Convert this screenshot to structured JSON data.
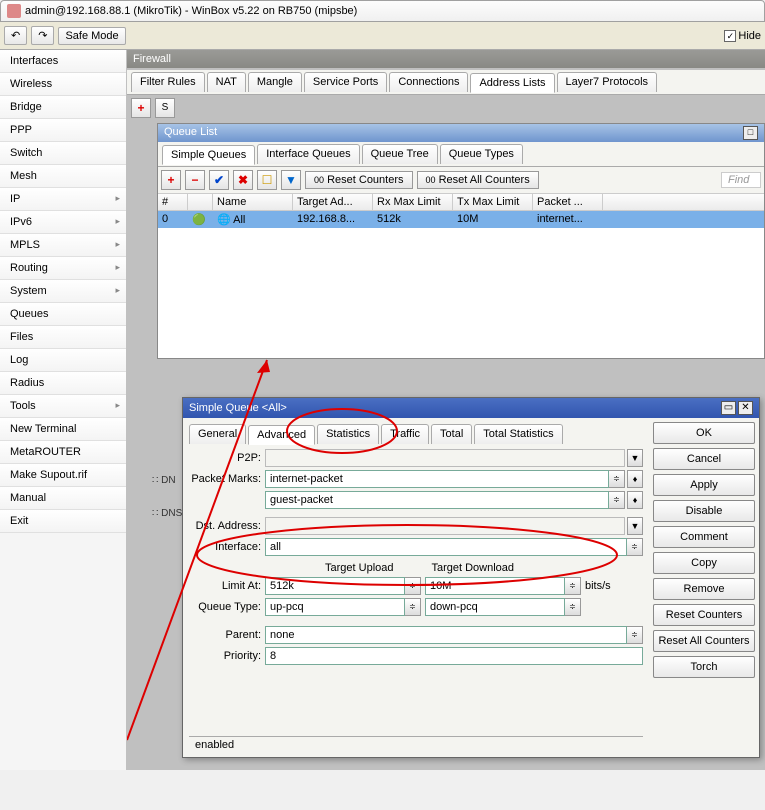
{
  "window": {
    "title": "admin@192.168.88.1 (MikroTik) - WinBox v5.22 on RB750 (mipsbe)"
  },
  "toolbar": {
    "safe_mode": "Safe Mode",
    "hide": "Hide"
  },
  "sidebar": {
    "items": [
      {
        "label": "Interfaces"
      },
      {
        "label": "Wireless"
      },
      {
        "label": "Bridge"
      },
      {
        "label": "PPP"
      },
      {
        "label": "Switch"
      },
      {
        "label": "Mesh"
      },
      {
        "label": "IP",
        "sub": true
      },
      {
        "label": "IPv6",
        "sub": true
      },
      {
        "label": "MPLS",
        "sub": true
      },
      {
        "label": "Routing",
        "sub": true
      },
      {
        "label": "System",
        "sub": true
      },
      {
        "label": "Queues"
      },
      {
        "label": "Files"
      },
      {
        "label": "Log"
      },
      {
        "label": "Radius"
      },
      {
        "label": "Tools",
        "sub": true
      },
      {
        "label": "New Terminal"
      },
      {
        "label": "MetaROUTER"
      },
      {
        "label": "Make Supout.rif"
      },
      {
        "label": "Manual"
      },
      {
        "label": "Exit"
      }
    ]
  },
  "firewall": {
    "title": "Firewall",
    "tabs": [
      "Filter Rules",
      "NAT",
      "Mangle",
      "Service Ports",
      "Connections",
      "Address Lists",
      "Layer7 Protocols"
    ],
    "active": 5
  },
  "queue": {
    "title": "Queue List",
    "tabs": [
      "Simple Queues",
      "Interface Queues",
      "Queue Tree",
      "Queue Types"
    ],
    "active": 0,
    "reset": "Reset Counters",
    "reset_all": "Reset All Counters",
    "find": "Find",
    "columns": [
      "#",
      "",
      "Name",
      "Target Ad...",
      "Rx Max Limit",
      "Tx Max Limit",
      "Packet ..."
    ],
    "row": {
      "num": "0",
      "name": "All",
      "target": "192.168.8...",
      "rx": "512k",
      "tx": "10M",
      "packet": "internet..."
    }
  },
  "dialog": {
    "title": "Simple Queue <All>",
    "tabs": [
      "General",
      "Advanced",
      "Statistics",
      "Traffic",
      "Total",
      "Total Statistics"
    ],
    "active": 1,
    "buttons": [
      "OK",
      "Cancel",
      "Apply",
      "Disable",
      "Comment",
      "Copy",
      "Remove",
      "Reset Counters",
      "Reset All Counters",
      "Torch"
    ],
    "fields": {
      "p2p_label": "P2P:",
      "packet_marks_label": "Packet Marks:",
      "packet_mark1": "internet-packet",
      "packet_mark2": "guest-packet",
      "dst_label": "Dst. Address:",
      "interface_label": "Interface:",
      "interface": "all",
      "upload_label": "Target Upload",
      "download_label": "Target Download",
      "limit_label": "Limit At:",
      "limit_up": "512k",
      "limit_dn": "10M",
      "unit": "bits/s",
      "qtype_label": "Queue Type:",
      "qtype_up": "up-pcq",
      "qtype_dn": "down-pcq",
      "parent_label": "Parent:",
      "parent": "none",
      "priority_label": "Priority:",
      "priority": "8"
    },
    "status": "enabled"
  },
  "tree": {
    "dns1": "DN",
    "dns2": "DNS"
  }
}
